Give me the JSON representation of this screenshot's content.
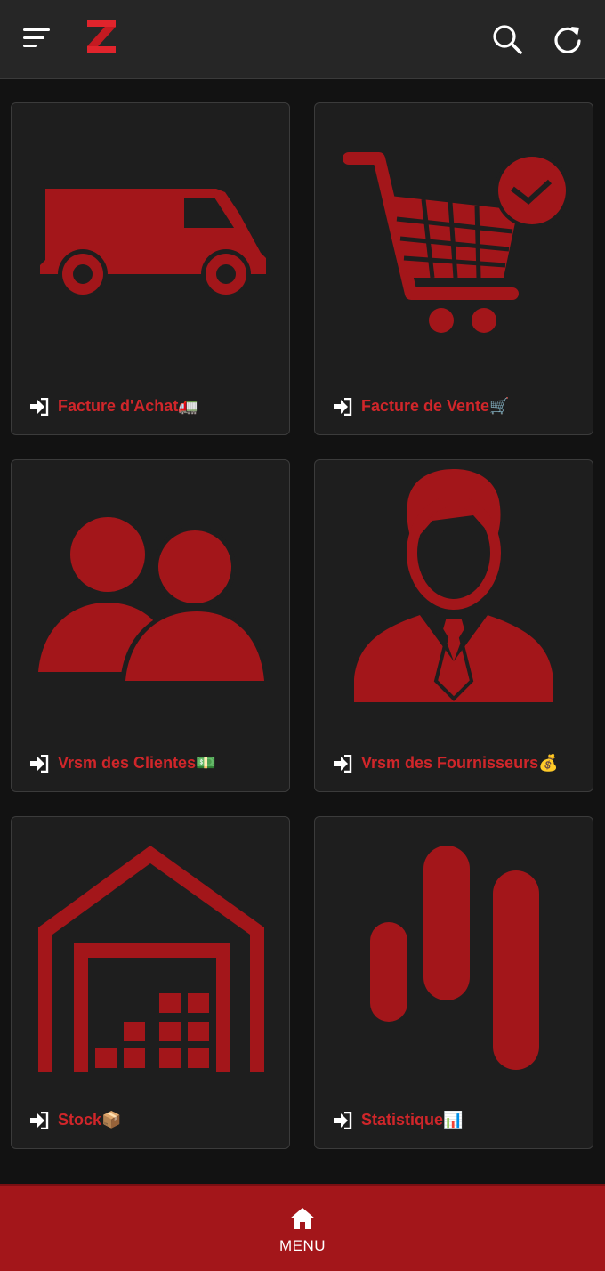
{
  "header": {
    "menu_icon": "hamburger-icon",
    "logo_letter": "Z",
    "search_icon": "search-icon",
    "refresh_icon": "refresh-icon"
  },
  "cards": [
    {
      "label": "Facture d'Achat🚛",
      "icon": "delivery-van-icon"
    },
    {
      "label": "Facture de Vente🛒",
      "icon": "shopping-cart-check-icon"
    },
    {
      "label": "Vrsm des Clientes💵",
      "icon": "users-icon"
    },
    {
      "label": "Vrsm des Fournisseurs💰",
      "icon": "businessman-icon"
    },
    {
      "label": "Stock📦",
      "icon": "warehouse-icon"
    },
    {
      "label": "Statistique📊",
      "icon": "bar-chart-icon"
    }
  ],
  "bottom_nav": {
    "label": "MENU",
    "icon": "home-icon"
  },
  "colors": {
    "accent": "#a3161a",
    "card_bg": "#1e1e1e",
    "bg": "#121212",
    "header_bg": "#262626"
  }
}
